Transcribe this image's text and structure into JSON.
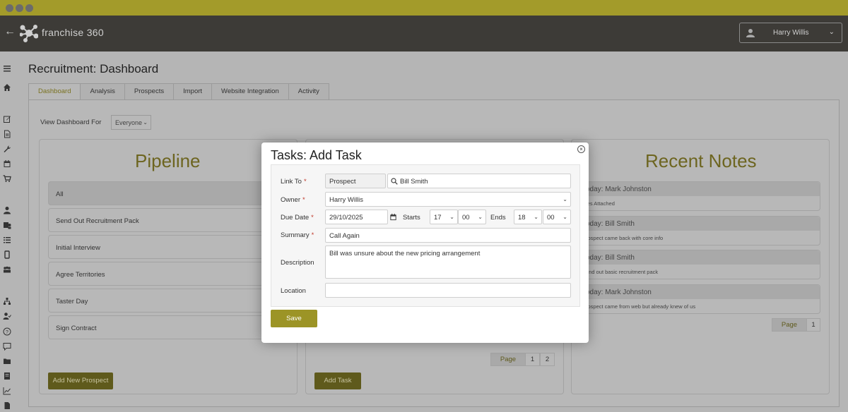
{
  "app": {
    "name": "franchise 360",
    "user": "Harry Willis"
  },
  "colors": {
    "accent": "#9c9426",
    "header": "#3d3b37",
    "titlebar": "#a39b2a"
  },
  "page": {
    "title": "Recruitment: Dashboard",
    "tabs": [
      "Dashboard",
      "Analysis",
      "Prospects",
      "Import",
      "Website Integration",
      "Activity"
    ],
    "view_label": "View Dashboard For",
    "view_value": "Everyone"
  },
  "pipeline": {
    "title": "Pipeline",
    "items": [
      "All",
      "Send Out Recruitment Pack",
      "Initial Interview",
      "Agree Territories",
      "Taster Day",
      "Sign Contract"
    ],
    "add_button": "Add New Prospect"
  },
  "tasks_panel": {
    "add_button": "Add Task",
    "pager": {
      "label": "Page",
      "pages": [
        "1",
        "2"
      ]
    }
  },
  "notes": {
    "title": "Recent Notes",
    "items": [
      {
        "header": "oday: Mark Johnston",
        "body": "les Attached"
      },
      {
        "header": "oday: Bill Smith",
        "body": "rospect came back with core info"
      },
      {
        "header": "oday: Bill Smith",
        "body": "end out basic recruitment pack"
      },
      {
        "header": "oday: Mark Johnston",
        "body": "rospect came from web but already knew of us"
      }
    ],
    "pager": {
      "label": "Page",
      "pages": [
        "1"
      ]
    }
  },
  "modal": {
    "title": "Tasks: Add Task",
    "labels": {
      "link_to": "Link To",
      "owner": "Owner",
      "due_date": "Due Date",
      "summary": "Summary",
      "description": "Description",
      "location": "Location",
      "starts": "Starts",
      "ends": "Ends"
    },
    "values": {
      "link_type": "Prospect",
      "link_name": "Bill Smith",
      "owner": "Harry Willis",
      "due_date": "29/10/2025",
      "start_hour": "17",
      "start_min": "00",
      "end_hour": "18",
      "end_min": "00",
      "summary": "Call Again",
      "description": "Bill was unsure about the new pricing arrangement",
      "location": ""
    },
    "save_button": "Save"
  }
}
